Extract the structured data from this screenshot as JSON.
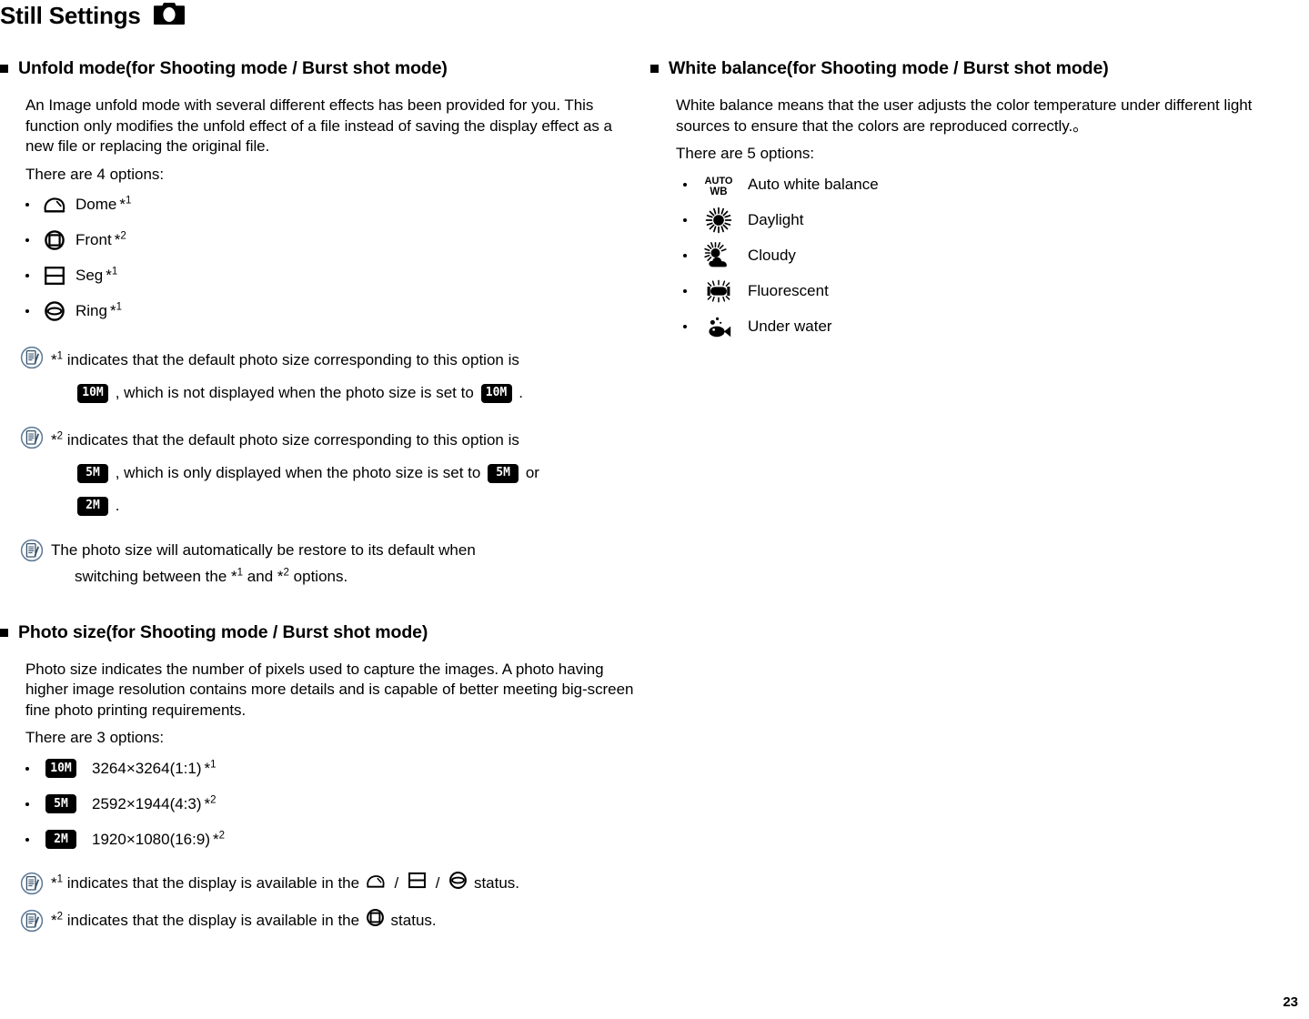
{
  "header": {
    "title": "Still Settings",
    "icon": "camera-icon"
  },
  "page_number": "23",
  "left_column": {
    "unfold": {
      "heading": "Unfold mode(for Shooting mode / Burst shot mode)",
      "paragraph": "An Image unfold mode with several different effects has been provided for you. This function only modifies the unfold effect of a file instead of saving the display effect as a new file or replacing the original file.",
      "lead_in": "There are 4 options:",
      "options": [
        {
          "icon": "dome-icon",
          "label": "Dome",
          "asterisk": "*",
          "note_ref": "1"
        },
        {
          "icon": "front-icon",
          "label": "Front",
          "asterisk": "*",
          "note_ref": "2"
        },
        {
          "icon": "seg-icon",
          "label": "Seg",
          "asterisk": "*",
          "note_ref": "1"
        },
        {
          "icon": "ring-icon",
          "label": "Ring",
          "asterisk": "*",
          "note_ref": "1"
        }
      ],
      "notes": [
        {
          "ref": "1",
          "line1": "indicates that the default photo size corresponding to this option is",
          "badge_a": "10M",
          "mid": ", which is not displayed when the photo size is set to",
          "badge_b": "10M",
          "tail": "."
        },
        {
          "ref": "2",
          "line1": "indicates that the default photo size corresponding to this option is",
          "badge_a": "5M",
          "mid": ", which is only displayed when the photo size is set to",
          "badge_b": "5M",
          "conj": "or",
          "badge_c": "2M",
          "tail": "."
        }
      ],
      "restore_note": {
        "line1": "The photo size will automatically be restore to its default when",
        "line2_pre": "switching between the",
        "ref_a": "1",
        "line2_mid": "and",
        "ref_b": "2",
        "line2_post": "options."
      }
    },
    "photo_size": {
      "heading": "Photo size(for Shooting mode / Burst shot mode)",
      "paragraph": "Photo size indicates the number of pixels used to capture the images. A photo having higher image resolution contains more details and is capable of better meeting big-screen fine photo printing requirements.",
      "lead_in": "There are 3 options:",
      "options": [
        {
          "badge": "10M",
          "label": "3264×3264(1:1)",
          "asterisk": "*",
          "note_ref": "1"
        },
        {
          "badge": "5M",
          "label": "2592×1944(4:3)",
          "asterisk": "*",
          "note_ref": "2"
        },
        {
          "badge": "2M",
          "label": "1920×1080(16:9)",
          "asterisk": "*",
          "note_ref": "2"
        }
      ],
      "notes": [
        {
          "ref": "1",
          "pre": "indicates that the display is available in the",
          "icons": [
            "dome-icon",
            "seg-icon",
            "ring-icon"
          ],
          "post": "status."
        },
        {
          "ref": "2",
          "pre": "indicates that the display is available in the",
          "icons": [
            "front-icon"
          ],
          "post": "status."
        }
      ]
    }
  },
  "right_column": {
    "white_balance": {
      "heading": "White balance(for Shooting mode / Burst shot mode)",
      "paragraph": "White balance means that the user adjusts the color temperature under different light sources to ensure that the colors are reproduced correctly.。",
      "lead_in": "There are 5 options:",
      "options": [
        {
          "icon": "auto-wb-icon",
          "label": "Auto white balance"
        },
        {
          "icon": "daylight-icon",
          "label": "Daylight"
        },
        {
          "icon": "cloudy-icon",
          "label": "Cloudy"
        },
        {
          "icon": "fluorescent-icon",
          "label": "Fluorescent"
        },
        {
          "icon": "underwater-icon",
          "label": "Under water"
        }
      ]
    }
  },
  "colors": {
    "text": "#000000",
    "note_icon": "#5a7896",
    "background": "#ffffff"
  }
}
